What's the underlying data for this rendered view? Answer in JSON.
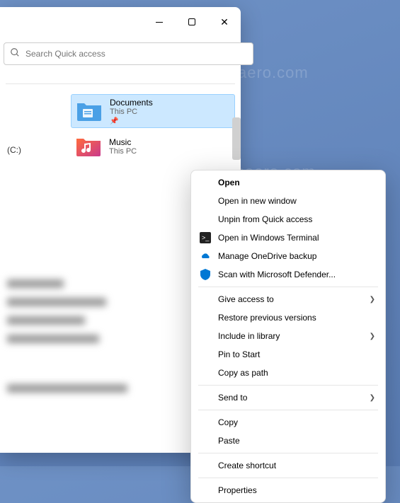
{
  "watermark": "winaero.com",
  "search": {
    "placeholder": "Search Quick access"
  },
  "drive_label": "(C:)",
  "folders": [
    {
      "name": "Documents",
      "sub": "This PC",
      "pinned": true
    },
    {
      "name": "Music",
      "sub": "This PC",
      "pinned": false
    }
  ],
  "menu": {
    "sec1": [
      {
        "label": "Open",
        "bold": true
      },
      {
        "label": "Open in new window"
      },
      {
        "label": "Unpin from Quick access"
      },
      {
        "label": "Open in Windows Terminal",
        "icon": "terminal"
      },
      {
        "label": "Manage OneDrive backup",
        "icon": "onedrive"
      },
      {
        "label": "Scan with Microsoft Defender...",
        "icon": "defender"
      }
    ],
    "sec2": [
      {
        "label": "Give access to",
        "sub": true
      },
      {
        "label": "Restore previous versions"
      },
      {
        "label": "Include in library",
        "sub": true
      },
      {
        "label": "Pin to Start"
      },
      {
        "label": "Copy as path"
      }
    ],
    "sec3": [
      {
        "label": "Send to",
        "sub": true
      }
    ],
    "sec4": [
      {
        "label": "Copy"
      },
      {
        "label": "Paste"
      }
    ],
    "sec5": [
      {
        "label": "Create shortcut"
      }
    ],
    "sec6": [
      {
        "label": "Properties"
      }
    ]
  }
}
